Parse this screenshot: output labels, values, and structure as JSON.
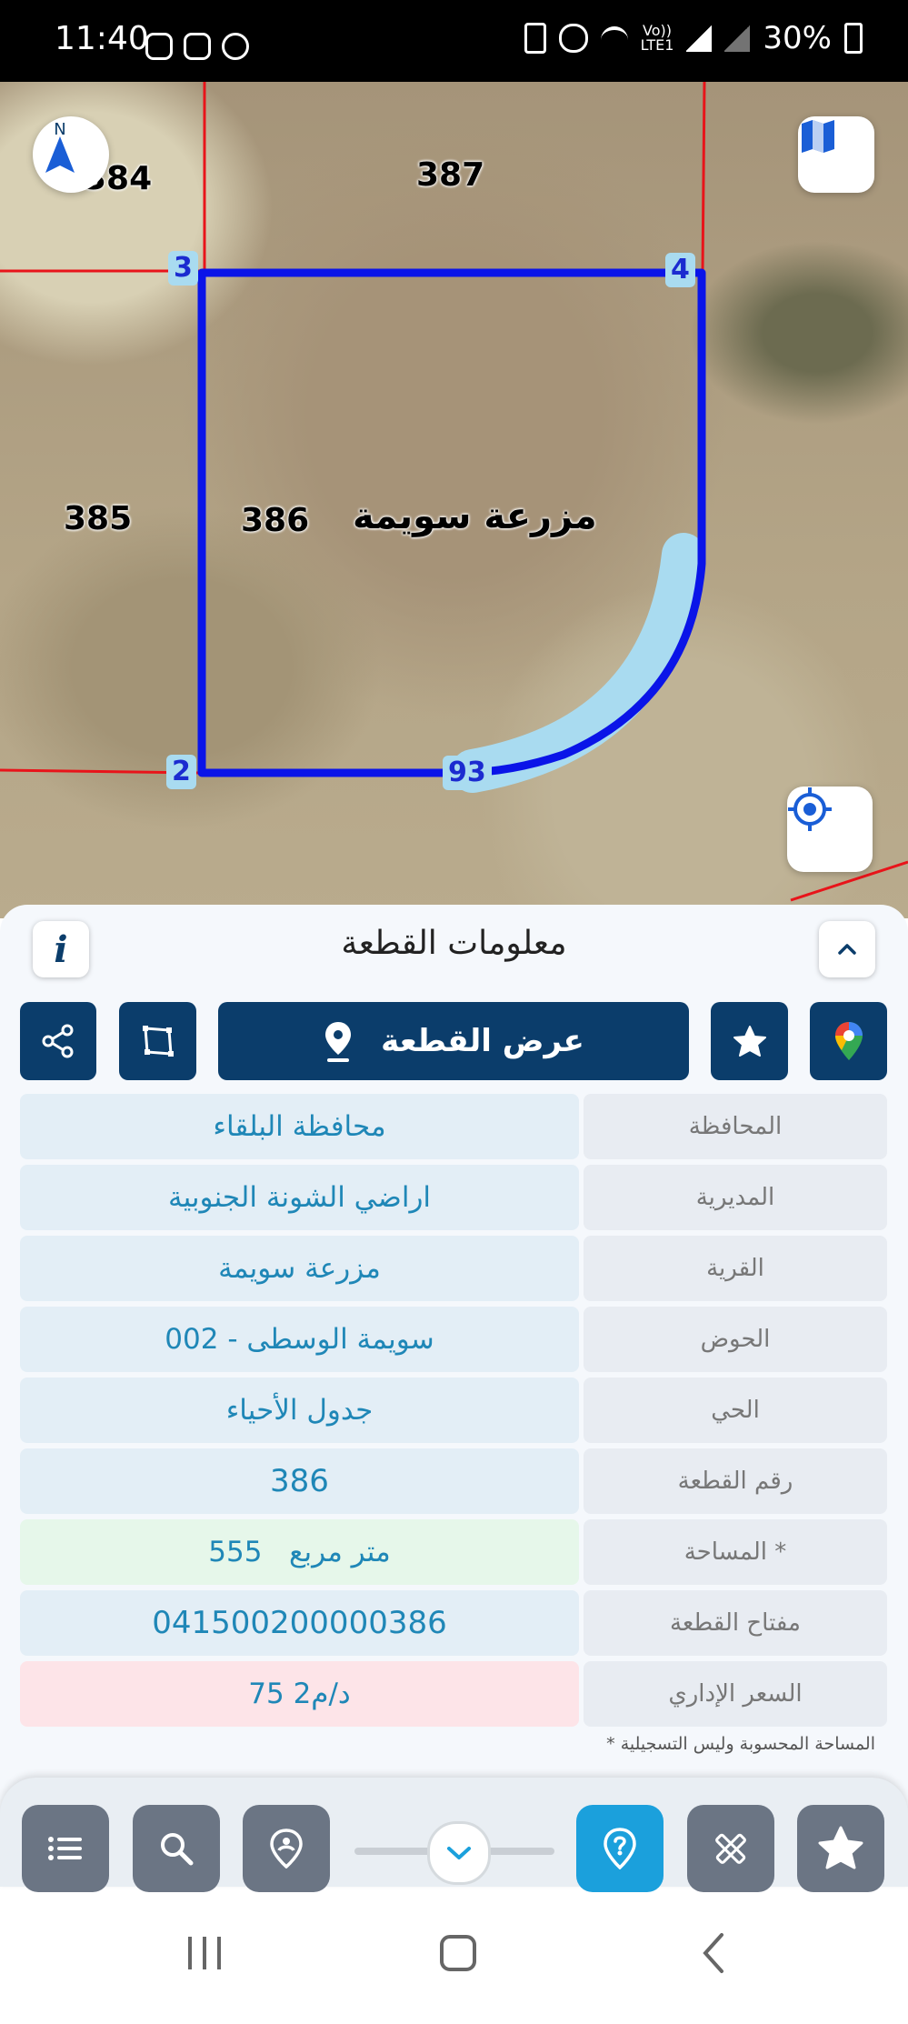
{
  "status_bar": {
    "time": "11:40",
    "battery": "30%",
    "volte_line1": "Vo))",
    "volte_line2": "LTE1"
  },
  "map": {
    "parcels": [
      "387",
      "384",
      "385",
      "386"
    ],
    "locality_label": "مزرعة سويمة",
    "vertices": [
      "3",
      "4",
      "2",
      "93"
    ],
    "compass_letter": "N",
    "colors": {
      "parcel_outline": "#0a14e8",
      "neighbor_lines": "#e8141a",
      "highlight_arc": "#a9dbf0"
    }
  },
  "panel": {
    "title": "معلومات القطعة",
    "info_glyph": "i",
    "view_parcel_label": "عرض القطعة",
    "rows": [
      {
        "label": "المحافظة",
        "value": "محافظة البلقاء"
      },
      {
        "label": "المديرية",
        "value": "اراضي الشونة الجنوبية"
      },
      {
        "label": "القرية",
        "value": "مزرعة سويمة"
      },
      {
        "label": "الحوض",
        "value": "سويمة الوسطى - 002"
      },
      {
        "label": "الحي",
        "value": "جدول الأحياء"
      },
      {
        "label": "رقم القطعة",
        "value": "386"
      },
      {
        "label": "المساحة *",
        "value": "555   متر مربع"
      },
      {
        "label": "مفتاح القطعة",
        "value": "041500200000386"
      },
      {
        "label": "السعر الإداري",
        "value": "75 د/م2"
      }
    ],
    "footnote": "* المساحة المحسوبة وليس التسجيلية"
  },
  "colors": {
    "primary": "#0b3d6b",
    "accent": "#1ba0dc",
    "nav_button": "#6b7584",
    "value_text": "#1f87b7"
  }
}
